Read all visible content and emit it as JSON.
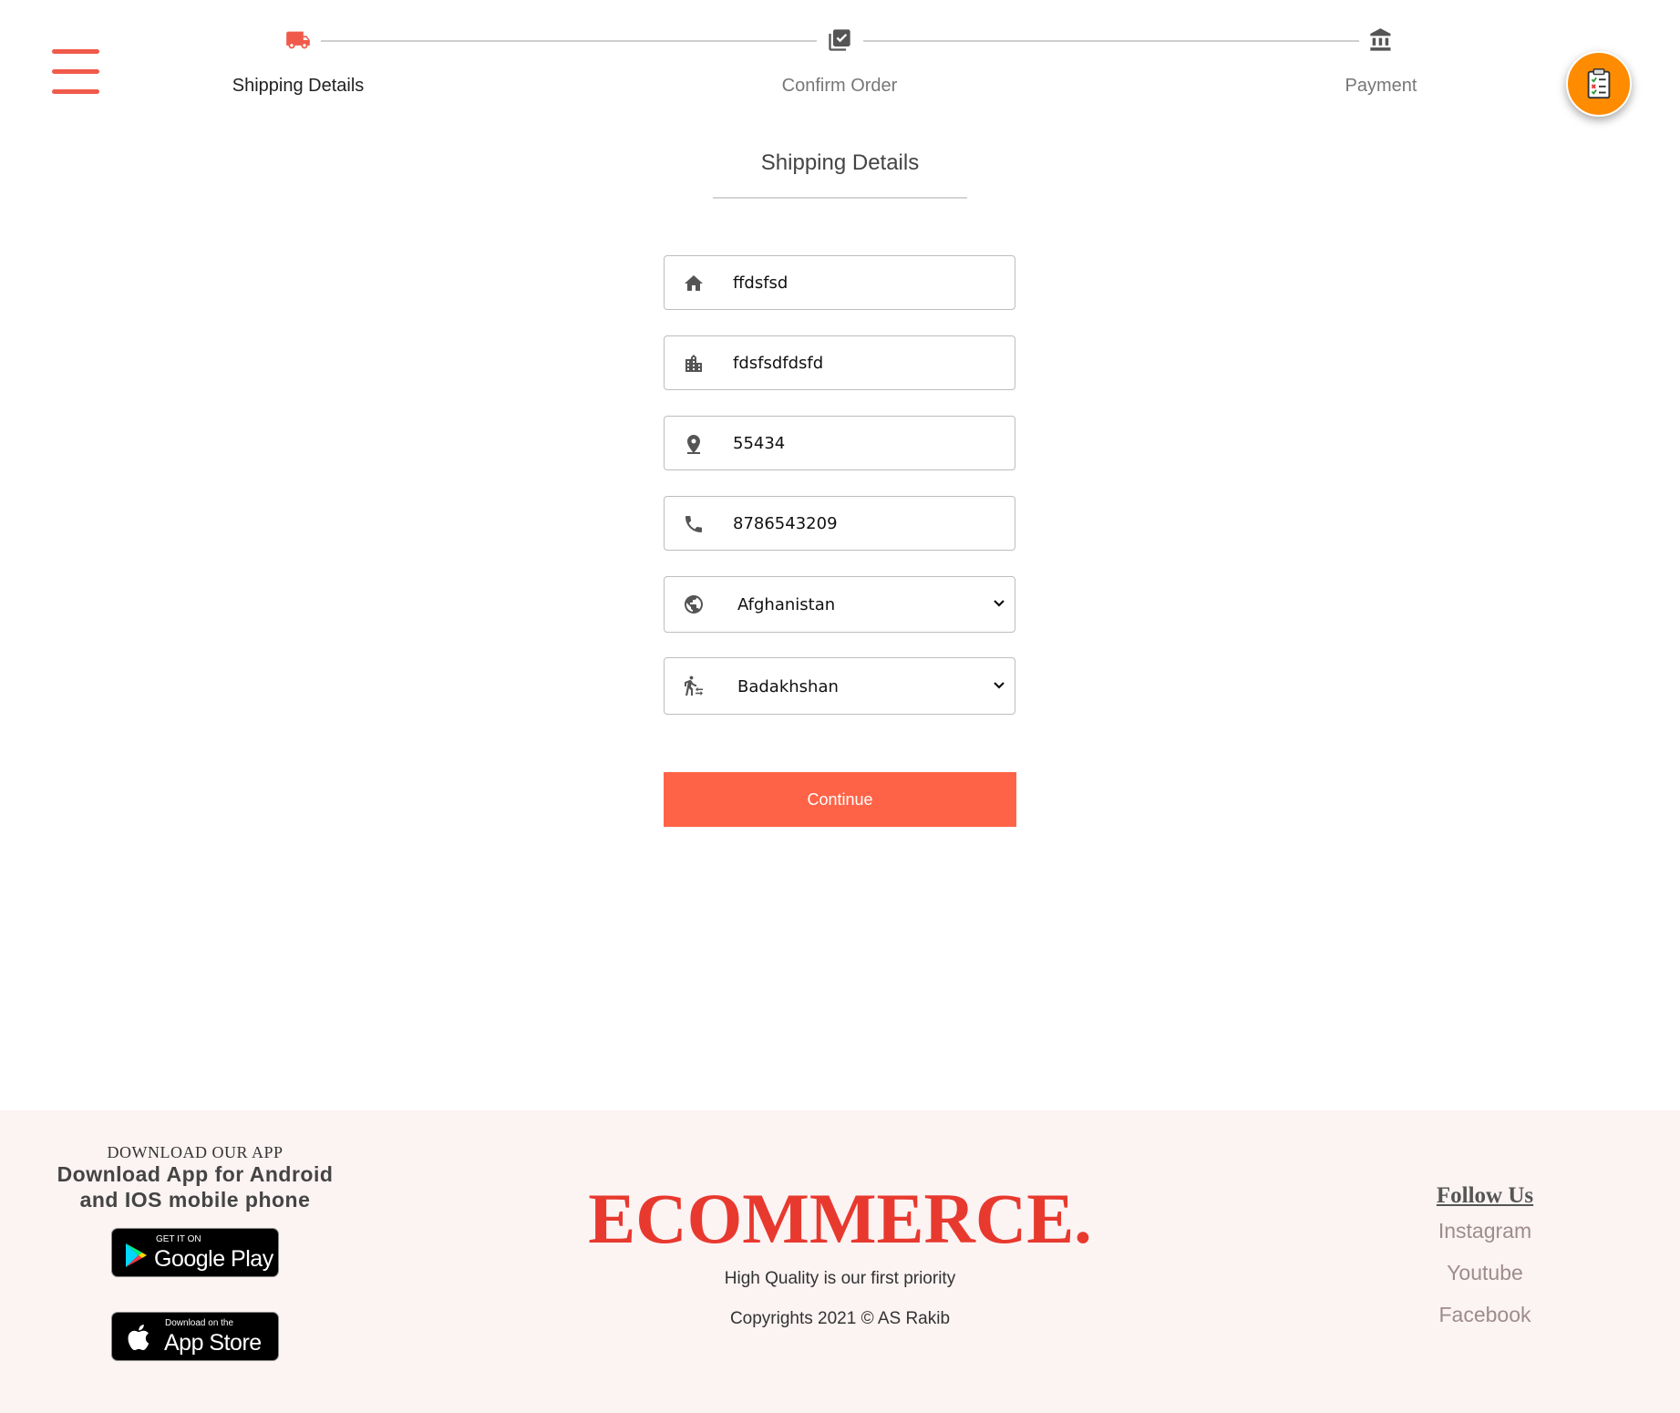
{
  "stepper": {
    "steps": [
      {
        "label": "Shipping Details",
        "icon": "truck-icon"
      },
      {
        "label": "Confirm Order",
        "icon": "order-check-icon"
      },
      {
        "label": "Payment",
        "icon": "bank-icon"
      }
    ],
    "active_step": 0,
    "accent_color": "#f05a4a"
  },
  "form": {
    "title": "Shipping Details",
    "address": "ffdsfsd",
    "city": "fdsfsdfdsfd",
    "pincode": "55434",
    "phone": "8786543209",
    "country": "Afghanistan",
    "state": "Badakhshan",
    "continue_label": "Continue"
  },
  "footer": {
    "download_heading": "DOWNLOAD OUR APP",
    "download_text_line1": "Download App for Android",
    "download_text_line2": "and IOS mobile phone",
    "google_play_small": "GET IT ON",
    "google_play_big": "Google Play",
    "app_store_small": "Download on the",
    "app_store_big": "App Store",
    "brand": "ECOMMERCE.",
    "tagline": "High Quality is our first priority",
    "copyright": "Copyrights 2021 © AS Rakib",
    "follow_heading": "Follow Us",
    "social_links": [
      "Instagram",
      "Youtube",
      "Facebook"
    ]
  },
  "colors": {
    "brand_red": "#e8392f",
    "button": "#ff6347",
    "fab": "#ff8c00"
  }
}
